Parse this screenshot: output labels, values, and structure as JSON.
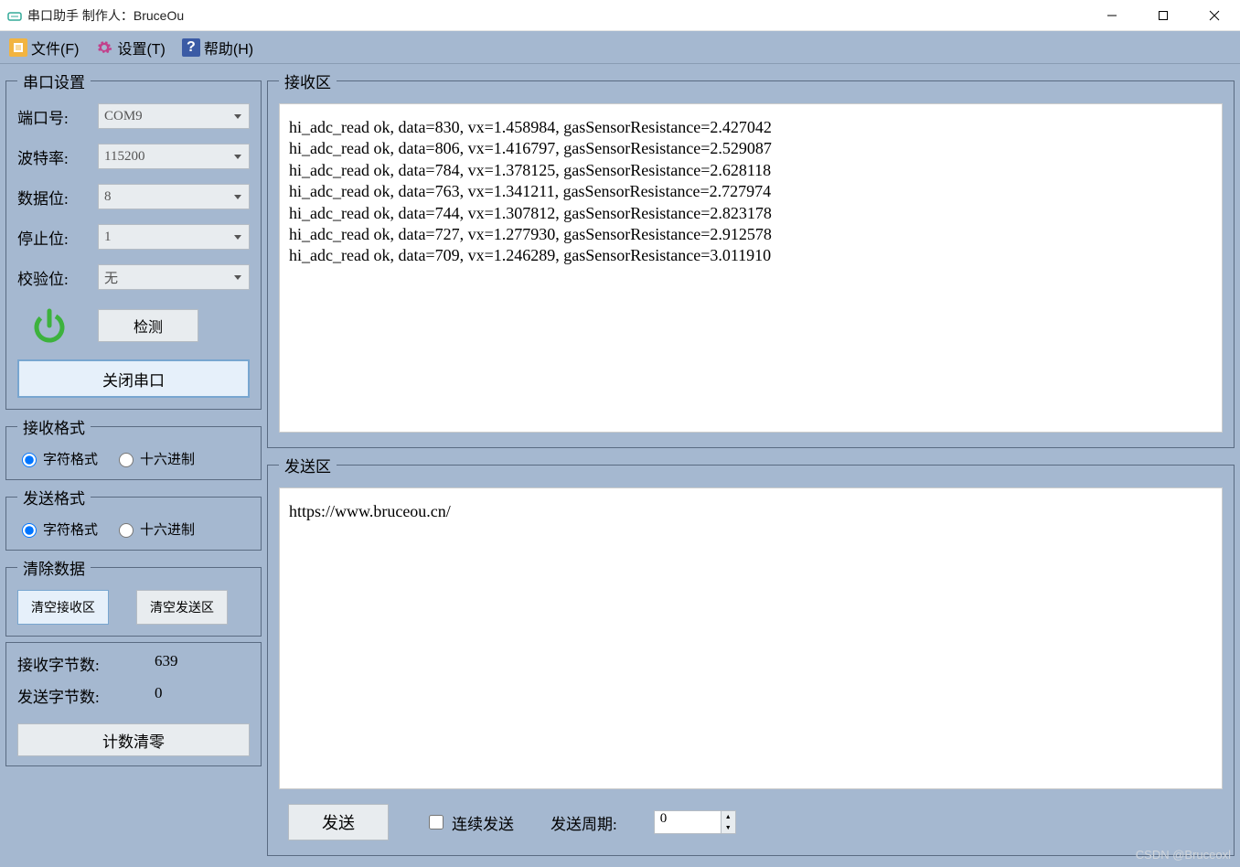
{
  "window": {
    "title": "串口助手 制作人：BruceOu"
  },
  "menu": {
    "file": "文件(F)",
    "settings": "设置(T)",
    "help": "帮助(H)"
  },
  "serial_settings": {
    "legend": "串口设置",
    "port_label": "端口号:",
    "port_value": "COM9",
    "baud_label": "波特率:",
    "baud_value": "115200",
    "databits_label": "数据位:",
    "databits_value": "8",
    "stopbits_label": "停止位:",
    "stopbits_value": "1",
    "parity_label": "校验位:",
    "parity_value": "无",
    "detect_button": "检测",
    "close_port_button": "关闭串口"
  },
  "recv_format": {
    "legend": "接收格式",
    "char_label": "字符格式",
    "hex_label": "十六进制",
    "selected": "char"
  },
  "send_format": {
    "legend": "发送格式",
    "char_label": "字符格式",
    "hex_label": "十六进制",
    "selected": "char"
  },
  "clear_data": {
    "legend": "清除数据",
    "clear_recv": "清空接收区",
    "clear_send": "清空发送区"
  },
  "stats": {
    "recv_label": "接收字节数:",
    "recv_value": "639",
    "send_label": "发送字节数:",
    "send_value": "0",
    "reset_button": "计数清零"
  },
  "recv_area": {
    "legend": "接收区",
    "content": "hi_adc_read ok, data=830, vx=1.458984, gasSensorResistance=2.427042\nhi_adc_read ok, data=806, vx=1.416797, gasSensorResistance=2.529087\nhi_adc_read ok, data=784, vx=1.378125, gasSensorResistance=2.628118\nhi_adc_read ok, data=763, vx=1.341211, gasSensorResistance=2.727974\nhi_adc_read ok, data=744, vx=1.307812, gasSensorResistance=2.823178\nhi_adc_read ok, data=727, vx=1.277930, gasSensorResistance=2.912578\nhi_adc_read ok, data=709, vx=1.246289, gasSensorResistance=3.011910"
  },
  "send_area": {
    "legend": "发送区",
    "content": "https://www.bruceou.cn/",
    "send_button": "发送",
    "continuous_label": "连续发送",
    "period_label": "发送周期:",
    "period_value": "0"
  },
  "watermark": "CSDN @Bruceoxl"
}
